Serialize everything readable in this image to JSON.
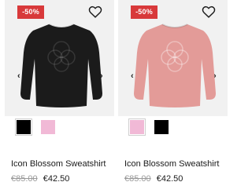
{
  "products": [
    {
      "discount_badge": "-50%",
      "title": "Icon Blossom Sweatshirt",
      "old_price": "€85.00",
      "new_price": "€42.50",
      "color": "#1b1b1b",
      "swatches": [
        {
          "color": "#000000",
          "selected": true
        },
        {
          "color": "#f1b9d6",
          "selected": false
        }
      ],
      "icons": {
        "wishlist": "heart-icon",
        "prev": "chevron-left-icon",
        "next": "chevron-right-icon"
      }
    },
    {
      "discount_badge": "-50%",
      "title": "Icon Blossom Sweatshirt",
      "old_price": "€85.00",
      "new_price": "€42.50",
      "color": "#e39b98",
      "swatches": [
        {
          "color": "#f1b9d6",
          "selected": true
        },
        {
          "color": "#000000",
          "selected": false
        }
      ],
      "icons": {
        "wishlist": "heart-icon",
        "prev": "chevron-left-icon",
        "next": "chevron-right-icon"
      }
    }
  ],
  "colors": {
    "badge": "#d8393a",
    "image_bg": "#f1f1f1",
    "price_old": "#9a9a9a"
  }
}
